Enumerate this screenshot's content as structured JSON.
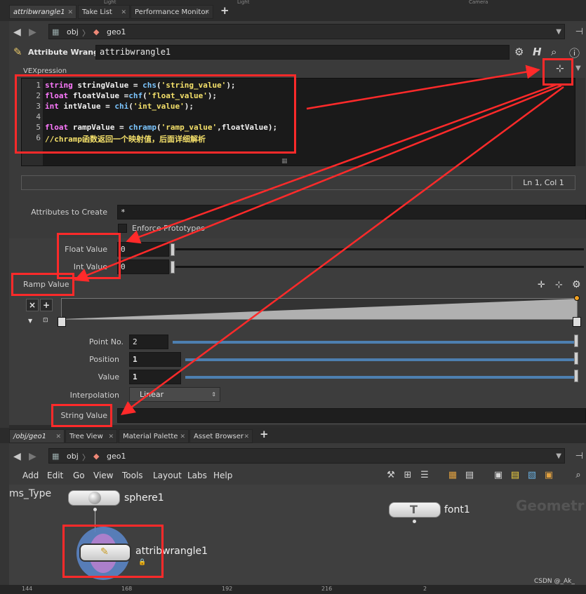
{
  "top_tabs": [
    {
      "label": "attribwrangle1",
      "active": true
    },
    {
      "label": "Take List",
      "active": false
    },
    {
      "label": "Performance Monitor",
      "active": false
    }
  ],
  "top_edge_labels": [
    "Light",
    "Light",
    "Camera"
  ],
  "path": {
    "root": "obj",
    "node": "geo1"
  },
  "header": {
    "node_type_label": "Attribute Wrangle",
    "node_name": "attribwrangle1"
  },
  "vex": {
    "section_label": "VEXpression",
    "lines": [
      {
        "num": "1",
        "parts": [
          {
            "t": "string",
            "c": "kw"
          },
          {
            "t": " stringValue = ",
            "c": ""
          },
          {
            "t": "chs",
            "c": "fn"
          },
          {
            "t": "(",
            "c": ""
          },
          {
            "t": "'string_value'",
            "c": "str"
          },
          {
            "t": ");",
            "c": ""
          }
        ]
      },
      {
        "num": "2",
        "parts": [
          {
            "t": "float",
            "c": "kw"
          },
          {
            "t": " floatValue =",
            "c": ""
          },
          {
            "t": "chf",
            "c": "fn"
          },
          {
            "t": "(",
            "c": ""
          },
          {
            "t": "'float_value'",
            "c": "str"
          },
          {
            "t": ");",
            "c": ""
          }
        ]
      },
      {
        "num": "3",
        "parts": [
          {
            "t": "int",
            "c": "kw"
          },
          {
            "t": " intValue = ",
            "c": ""
          },
          {
            "t": "chi",
            "c": "fn"
          },
          {
            "t": "(",
            "c": ""
          },
          {
            "t": "'int_value'",
            "c": "str"
          },
          {
            "t": ");",
            "c": ""
          }
        ]
      },
      {
        "num": "4",
        "parts": []
      },
      {
        "num": "5",
        "parts": [
          {
            "t": "float",
            "c": "kw"
          },
          {
            "t": " rampValue = ",
            "c": ""
          },
          {
            "t": "chramp",
            "c": "fn"
          },
          {
            "t": "(",
            "c": ""
          },
          {
            "t": "'ramp_value'",
            "c": "str"
          },
          {
            "t": ",floatValue);",
            "c": ""
          }
        ]
      },
      {
        "num": "6",
        "parts": [
          {
            "t": "//chramp函数返回一个映射值，后面详细解析",
            "c": "cmt"
          }
        ]
      }
    ],
    "status": "Ln 1, Col 1"
  },
  "params": {
    "attributes_label": "Attributes to Create",
    "attributes_value": "*",
    "enforce_label": "Enforce Prototypes",
    "float_label": "Float Value",
    "float_value": "0",
    "int_label": "Int Value",
    "int_value": "0",
    "ramp_label": "Ramp Value",
    "point_no_label": "Point No.",
    "point_no_value": "2",
    "position_label": "Position",
    "position_value": "1",
    "value_label": "Value",
    "value_value": "1",
    "interp_label": "Interpolation",
    "interp_value": "Linear",
    "string_label": "String Value"
  },
  "bottom_tabs": [
    {
      "label": "/obj/geo1",
      "active": true
    },
    {
      "label": "Tree View",
      "active": false
    },
    {
      "label": "Material Palette",
      "active": false
    },
    {
      "label": "Asset Browser",
      "active": false
    }
  ],
  "menu": [
    "Add",
    "Edit",
    "Go",
    "View",
    "Tools",
    "Layout",
    "Labs",
    "Help"
  ],
  "network": {
    "left_label": "ms_Type",
    "watermark": "Geometr",
    "nodes": {
      "sphere": "sphere1",
      "font": "font1",
      "wrangle": "attribwrangle1"
    }
  },
  "ruler_ticks": [
    "144",
    "168",
    "192",
    "216",
    "2"
  ],
  "credit": "CSDN @_Ak_",
  "colors": {
    "annotation": "#ff2a2a",
    "keyword": "#ff79ff",
    "function": "#7cc6ff",
    "string": "#f4e06a"
  }
}
